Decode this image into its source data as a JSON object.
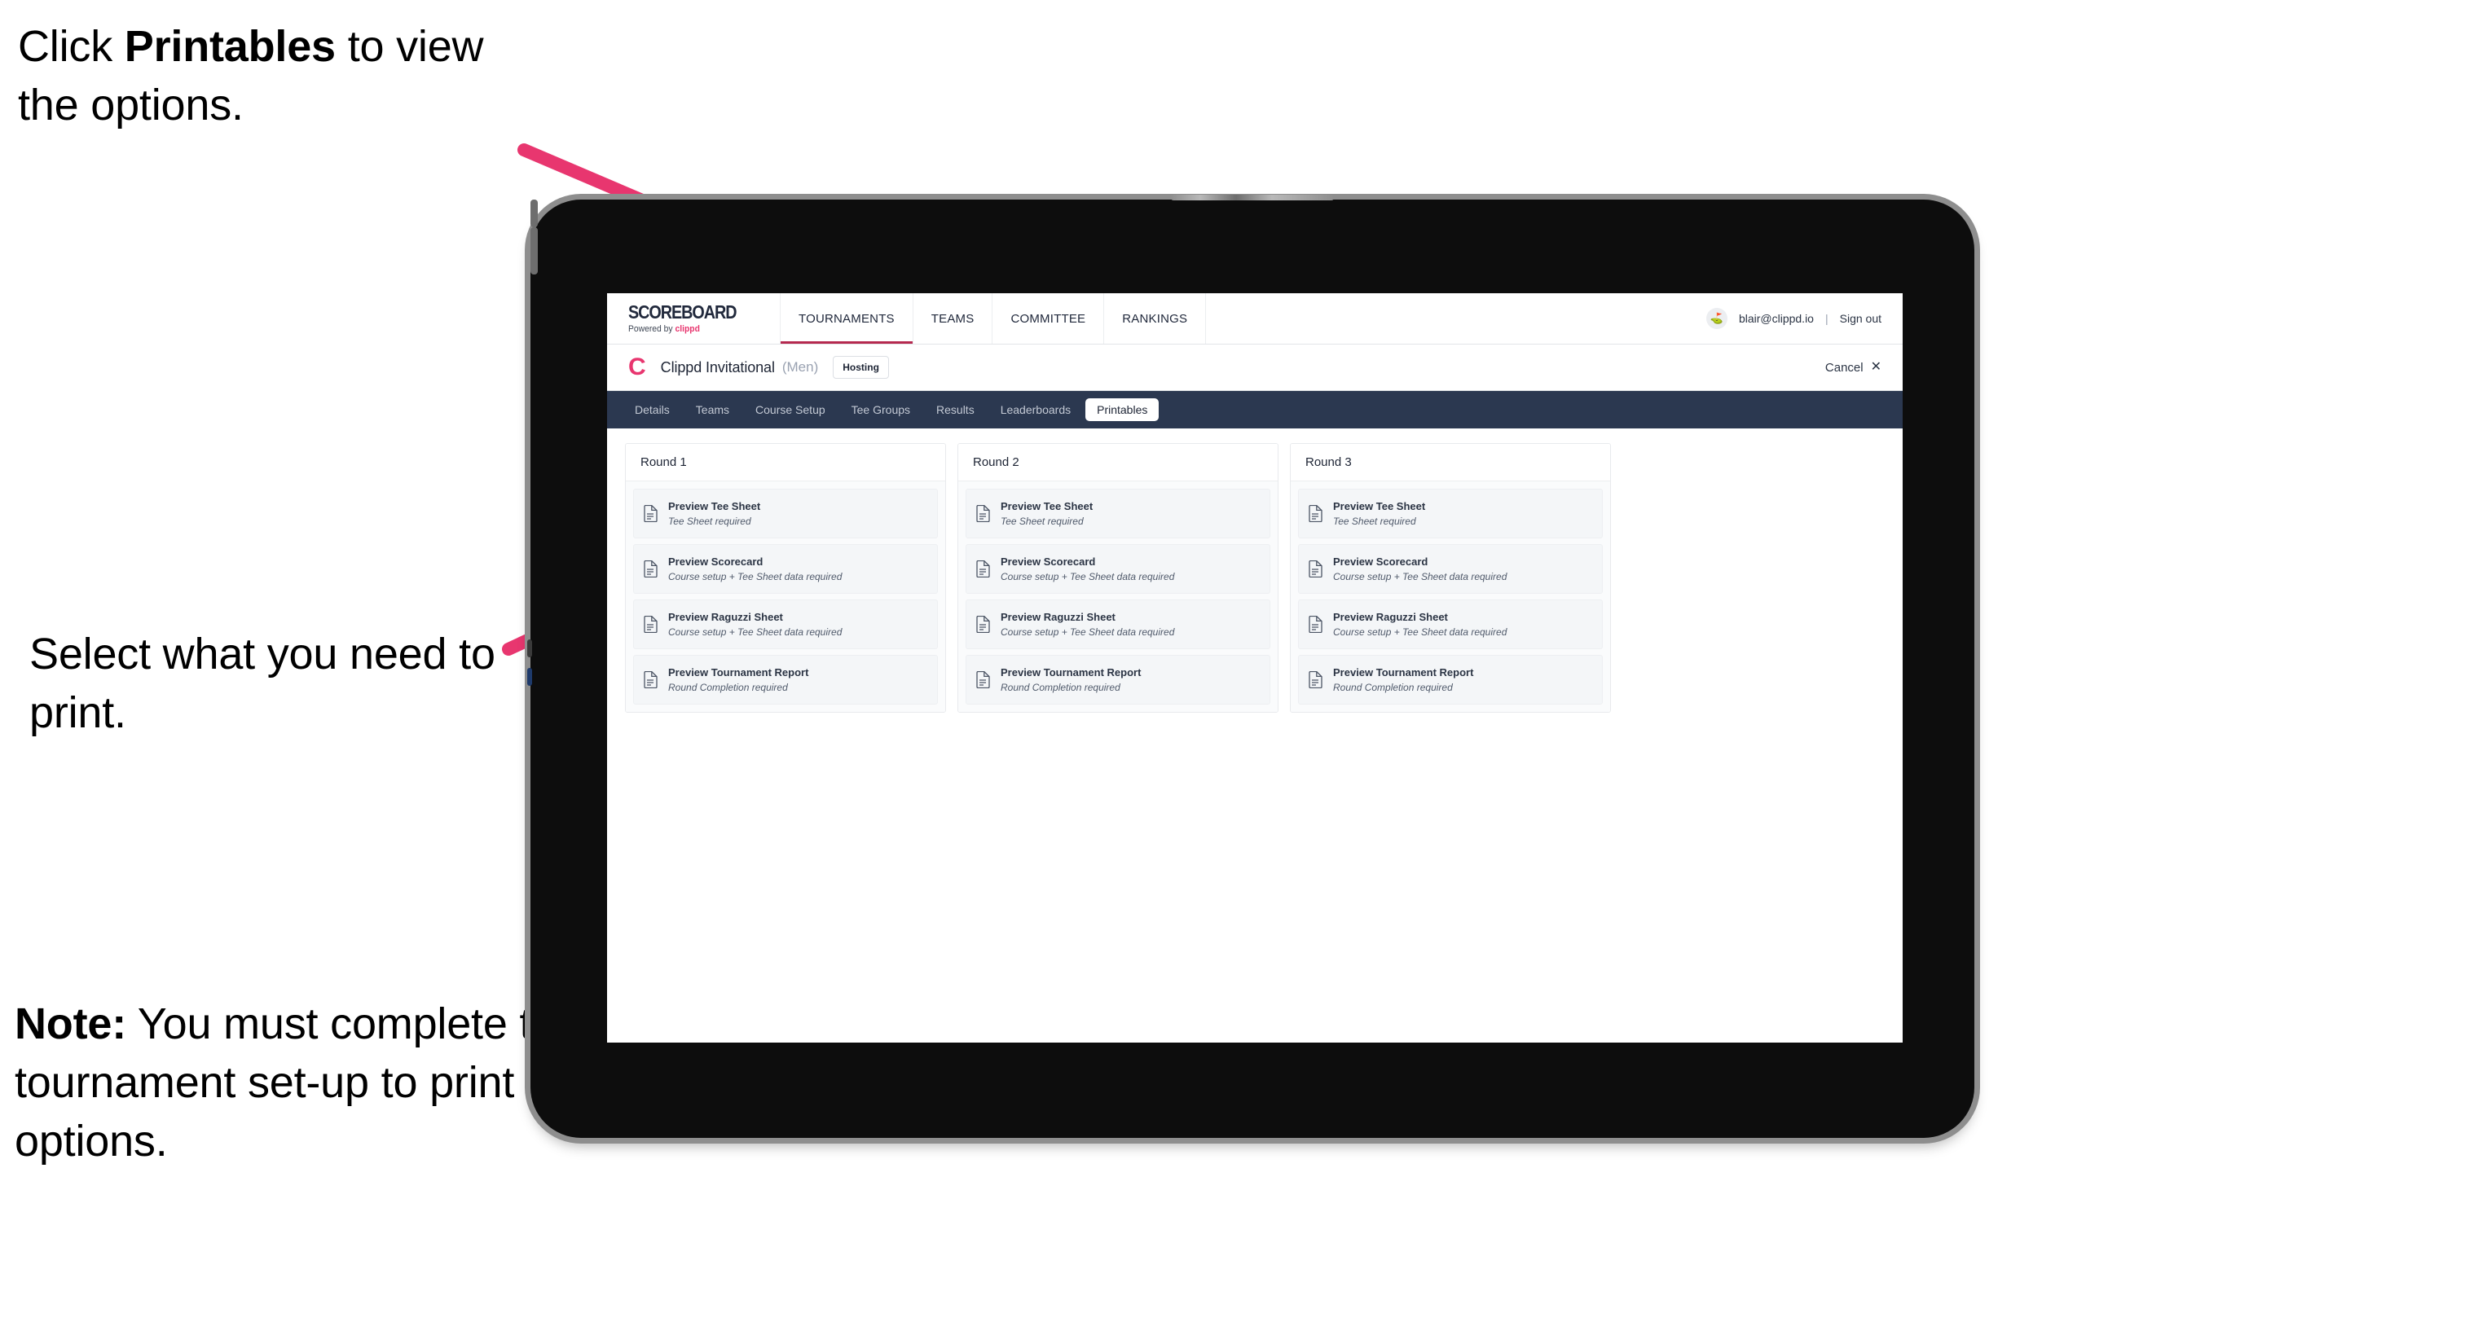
{
  "annotations": {
    "callout_1": {
      "prefix": "Click ",
      "bold": "Printables",
      "suffix": " to view the options."
    },
    "callout_2": {
      "text": "Select what you need to print."
    },
    "callout_3": {
      "bold": "Note:",
      "text": " You must complete the tournament set-up to print all the options."
    },
    "arrow_color": "#e8366f"
  },
  "app": {
    "top_nav": {
      "brand": {
        "name": "SCOREBOARD",
        "powered_prefix": "Powered by ",
        "powered_brand": "clippd"
      },
      "links": [
        {
          "label": "TOURNAMENTS",
          "active": true
        },
        {
          "label": "TEAMS",
          "active": false
        },
        {
          "label": "COMMITTEE",
          "active": false
        },
        {
          "label": "RANKINGS",
          "active": false
        }
      ],
      "account": {
        "avatar_glyph": "⛳",
        "email": "blair@clippd.io",
        "separator": "|",
        "sign_out": "Sign out"
      }
    },
    "tournament_bar": {
      "logo_letter": "C",
      "name": "Clippd Invitational",
      "gender": "(Men)",
      "status_badge": "Hosting",
      "cancel_label": "Cancel",
      "cancel_icon": "✕"
    },
    "tabs": [
      {
        "label": "Details",
        "active": false
      },
      {
        "label": "Teams",
        "active": false
      },
      {
        "label": "Course Setup",
        "active": false
      },
      {
        "label": "Tee Groups",
        "active": false
      },
      {
        "label": "Results",
        "active": false
      },
      {
        "label": "Leaderboards",
        "active": false
      },
      {
        "label": "Printables",
        "active": true
      }
    ],
    "printables": {
      "columns": [
        {
          "title": "Round 1",
          "items": [
            {
              "title": "Preview Tee Sheet",
              "subtitle": "Tee Sheet required"
            },
            {
              "title": "Preview Scorecard",
              "subtitle": "Course setup + Tee Sheet data required"
            },
            {
              "title": "Preview Raguzzi Sheet",
              "subtitle": "Course setup + Tee Sheet data required"
            },
            {
              "title": "Preview Tournament Report",
              "subtitle": "Round Completion required"
            }
          ]
        },
        {
          "title": "Round 2",
          "items": [
            {
              "title": "Preview Tee Sheet",
              "subtitle": "Tee Sheet required"
            },
            {
              "title": "Preview Scorecard",
              "subtitle": "Course setup + Tee Sheet data required"
            },
            {
              "title": "Preview Raguzzi Sheet",
              "subtitle": "Course setup + Tee Sheet data required"
            },
            {
              "title": "Preview Tournament Report",
              "subtitle": "Round Completion required"
            }
          ]
        },
        {
          "title": "Round 3",
          "items": [
            {
              "title": "Preview Tee Sheet",
              "subtitle": "Tee Sheet required"
            },
            {
              "title": "Preview Scorecard",
              "subtitle": "Course setup + Tee Sheet data required"
            },
            {
              "title": "Preview Raguzzi Sheet",
              "subtitle": "Course setup + Tee Sheet data required"
            },
            {
              "title": "Preview Tournament Report",
              "subtitle": "Round Completion required"
            }
          ]
        }
      ]
    },
    "colors": {
      "accent_pink": "#e8366f",
      "tabbar_navy": "#2b3850",
      "text_dark": "#1d2434"
    }
  }
}
